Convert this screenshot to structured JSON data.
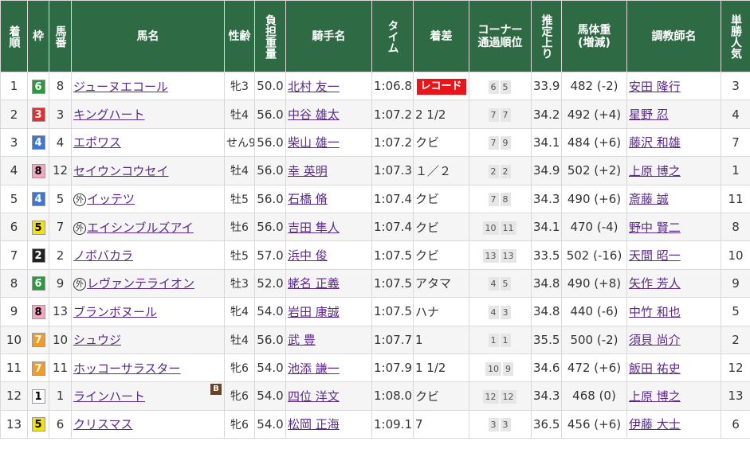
{
  "headers": {
    "rank": "着順",
    "waku": "枠",
    "umaban": "馬番",
    "horse": "馬名",
    "sexage": "性齢",
    "weight": "負担重量",
    "jockey": "騎手名",
    "time": "タイム",
    "margin": "着差",
    "corner_l1": "コーナー",
    "corner_l2": "通過順位",
    "last3f": "推定上り",
    "body_l1": "馬体重",
    "body_l2": "(増減)",
    "trainer": "調教師名",
    "pop": "単勝人気"
  },
  "record_label": "レコード",
  "foreign_mark": "外",
  "blinker_mark": "B",
  "waku_colors": {
    "1": {
      "bg": "#ffffff",
      "fg": "#000000"
    },
    "2": {
      "bg": "#222222",
      "fg": "#ffffff"
    },
    "3": {
      "bg": "#e62e2e",
      "fg": "#ffffff"
    },
    "4": {
      "bg": "#3a78d6",
      "fg": "#ffffff"
    },
    "5": {
      "bg": "#f4e300",
      "fg": "#000000"
    },
    "6": {
      "bg": "#2b9a3e",
      "fg": "#ffffff"
    },
    "7": {
      "bg": "#f59a23",
      "fg": "#ffffff"
    },
    "8": {
      "bg": "#f7a6c1",
      "fg": "#000000"
    }
  },
  "rows": [
    {
      "rank": "1",
      "waku": "6",
      "umaban": "8",
      "horse": "ジューヌエコール",
      "foreign": false,
      "blinker": false,
      "sexage": "牝3",
      "weight": "50.0",
      "jockey": "北村 友一",
      "time": "1:06.8",
      "margin": "",
      "record": true,
      "corners": [
        "6",
        "5"
      ],
      "last3f": "33.9",
      "body": "482 (-2)",
      "trainer": "安田 隆行",
      "pop": "3"
    },
    {
      "rank": "2",
      "waku": "3",
      "umaban": "3",
      "horse": "キングハート",
      "foreign": false,
      "blinker": false,
      "sexage": "牡4",
      "weight": "56.0",
      "jockey": "中谷 雄太",
      "time": "1:07.2",
      "margin": "2 1/2",
      "record": false,
      "corners": [
        "7",
        "7"
      ],
      "last3f": "34.2",
      "body": "492 (+4)",
      "trainer": "星野 忍",
      "pop": "4"
    },
    {
      "rank": "3",
      "waku": "4",
      "umaban": "4",
      "horse": "エポワス",
      "foreign": false,
      "blinker": false,
      "sexage": "せん9",
      "weight": "56.0",
      "jockey": "柴山 雄一",
      "time": "1:07.2",
      "margin": "クビ",
      "record": false,
      "corners": [
        "7",
        "9"
      ],
      "last3f": "34.1",
      "body": "484 (+6)",
      "trainer": "藤沢 和雄",
      "pop": "7"
    },
    {
      "rank": "4",
      "waku": "8",
      "umaban": "12",
      "horse": "セイウンコウセイ",
      "foreign": false,
      "blinker": false,
      "sexage": "牡4",
      "weight": "56.0",
      "jockey": "幸 英明",
      "time": "1:07.3",
      "margin": "１／２",
      "record": false,
      "corners": [
        "2",
        "2"
      ],
      "last3f": "34.9",
      "body": "502 (+2)",
      "trainer": "上原 博之",
      "pop": "1"
    },
    {
      "rank": "5",
      "waku": "4",
      "umaban": "5",
      "horse": "イッテツ",
      "foreign": true,
      "blinker": false,
      "sexage": "牡5",
      "weight": "56.0",
      "jockey": "石橋 脩",
      "time": "1:07.4",
      "margin": "クビ",
      "record": false,
      "corners": [
        "7",
        "8"
      ],
      "last3f": "34.3",
      "body": "490 (+6)",
      "trainer": "斎藤 誠",
      "pop": "11"
    },
    {
      "rank": "6",
      "waku": "5",
      "umaban": "7",
      "horse": "エイシンブルズアイ",
      "foreign": true,
      "blinker": false,
      "sexage": "牡6",
      "weight": "56.0",
      "jockey": "吉田 隼人",
      "time": "1:07.4",
      "margin": "クビ",
      "record": false,
      "corners": [
        "10",
        "11"
      ],
      "last3f": "34.1",
      "body": "470 (-4)",
      "trainer": "野中 賢二",
      "pop": "8"
    },
    {
      "rank": "7",
      "waku": "2",
      "umaban": "2",
      "horse": "ノボバカラ",
      "foreign": false,
      "blinker": false,
      "sexage": "牡5",
      "weight": "57.0",
      "jockey": "浜中 俊",
      "time": "1:07.5",
      "margin": "クビ",
      "record": false,
      "corners": [
        "13",
        "13"
      ],
      "last3f": "33.5",
      "body": "502 (-16)",
      "trainer": "天間 昭一",
      "pop": "10"
    },
    {
      "rank": "8",
      "waku": "6",
      "umaban": "9",
      "horse": "レヴァンテライオン",
      "foreign": true,
      "blinker": false,
      "sexage": "牡3",
      "weight": "52.0",
      "jockey": "蛯名 正義",
      "time": "1:07.5",
      "margin": "アタマ",
      "record": false,
      "corners": [
        "4",
        "5"
      ],
      "last3f": "34.8",
      "body": "490 (+8)",
      "trainer": "矢作 芳人",
      "pop": "9"
    },
    {
      "rank": "9",
      "waku": "8",
      "umaban": "13",
      "horse": "ブランボヌール",
      "foreign": false,
      "blinker": false,
      "sexage": "牝4",
      "weight": "54.0",
      "jockey": "岩田 康誠",
      "time": "1:07.5",
      "margin": "ハナ",
      "record": false,
      "corners": [
        "4",
        "3"
      ],
      "last3f": "34.8",
      "body": "440 (-6)",
      "trainer": "中竹 和也",
      "pop": "5"
    },
    {
      "rank": "10",
      "waku": "7",
      "umaban": "10",
      "horse": "シュウジ",
      "foreign": false,
      "blinker": false,
      "sexage": "牡4",
      "weight": "56.0",
      "jockey": "武 豊",
      "time": "1:07.7",
      "margin": "1",
      "record": false,
      "corners": [
        "1",
        "1"
      ],
      "last3f": "35.5",
      "body": "500 (-2)",
      "trainer": "須貝 尚介",
      "pop": "2"
    },
    {
      "rank": "11",
      "waku": "7",
      "umaban": "11",
      "horse": "ホッコーサラスター",
      "foreign": false,
      "blinker": false,
      "sexage": "牝6",
      "weight": "54.0",
      "jockey": "池添 謙一",
      "time": "1:07.9",
      "margin": "1 1/2",
      "record": false,
      "corners": [
        "10",
        "9"
      ],
      "last3f": "34.6",
      "body": "472 (+6)",
      "trainer": "飯田 祐史",
      "pop": "12"
    },
    {
      "rank": "12",
      "waku": "1",
      "umaban": "1",
      "horse": "ラインハート",
      "foreign": false,
      "blinker": true,
      "sexage": "牝6",
      "weight": "54.0",
      "jockey": "四位 洋文",
      "time": "1:08.0",
      "margin": "クビ",
      "record": false,
      "corners": [
        "12",
        "12"
      ],
      "last3f": "34.3",
      "body": "468 (0)",
      "trainer": "上原 博之",
      "pop": "13"
    },
    {
      "rank": "13",
      "waku": "5",
      "umaban": "6",
      "horse": "クリスマス",
      "foreign": false,
      "blinker": false,
      "sexage": "牝6",
      "weight": "54.0",
      "jockey": "松岡 正海",
      "time": "1:09.1",
      "margin": "7",
      "record": false,
      "corners": [
        "3",
        "3"
      ],
      "last3f": "36.5",
      "body": "456 (+6)",
      "trainer": "伊藤 大士",
      "pop": "6"
    }
  ]
}
